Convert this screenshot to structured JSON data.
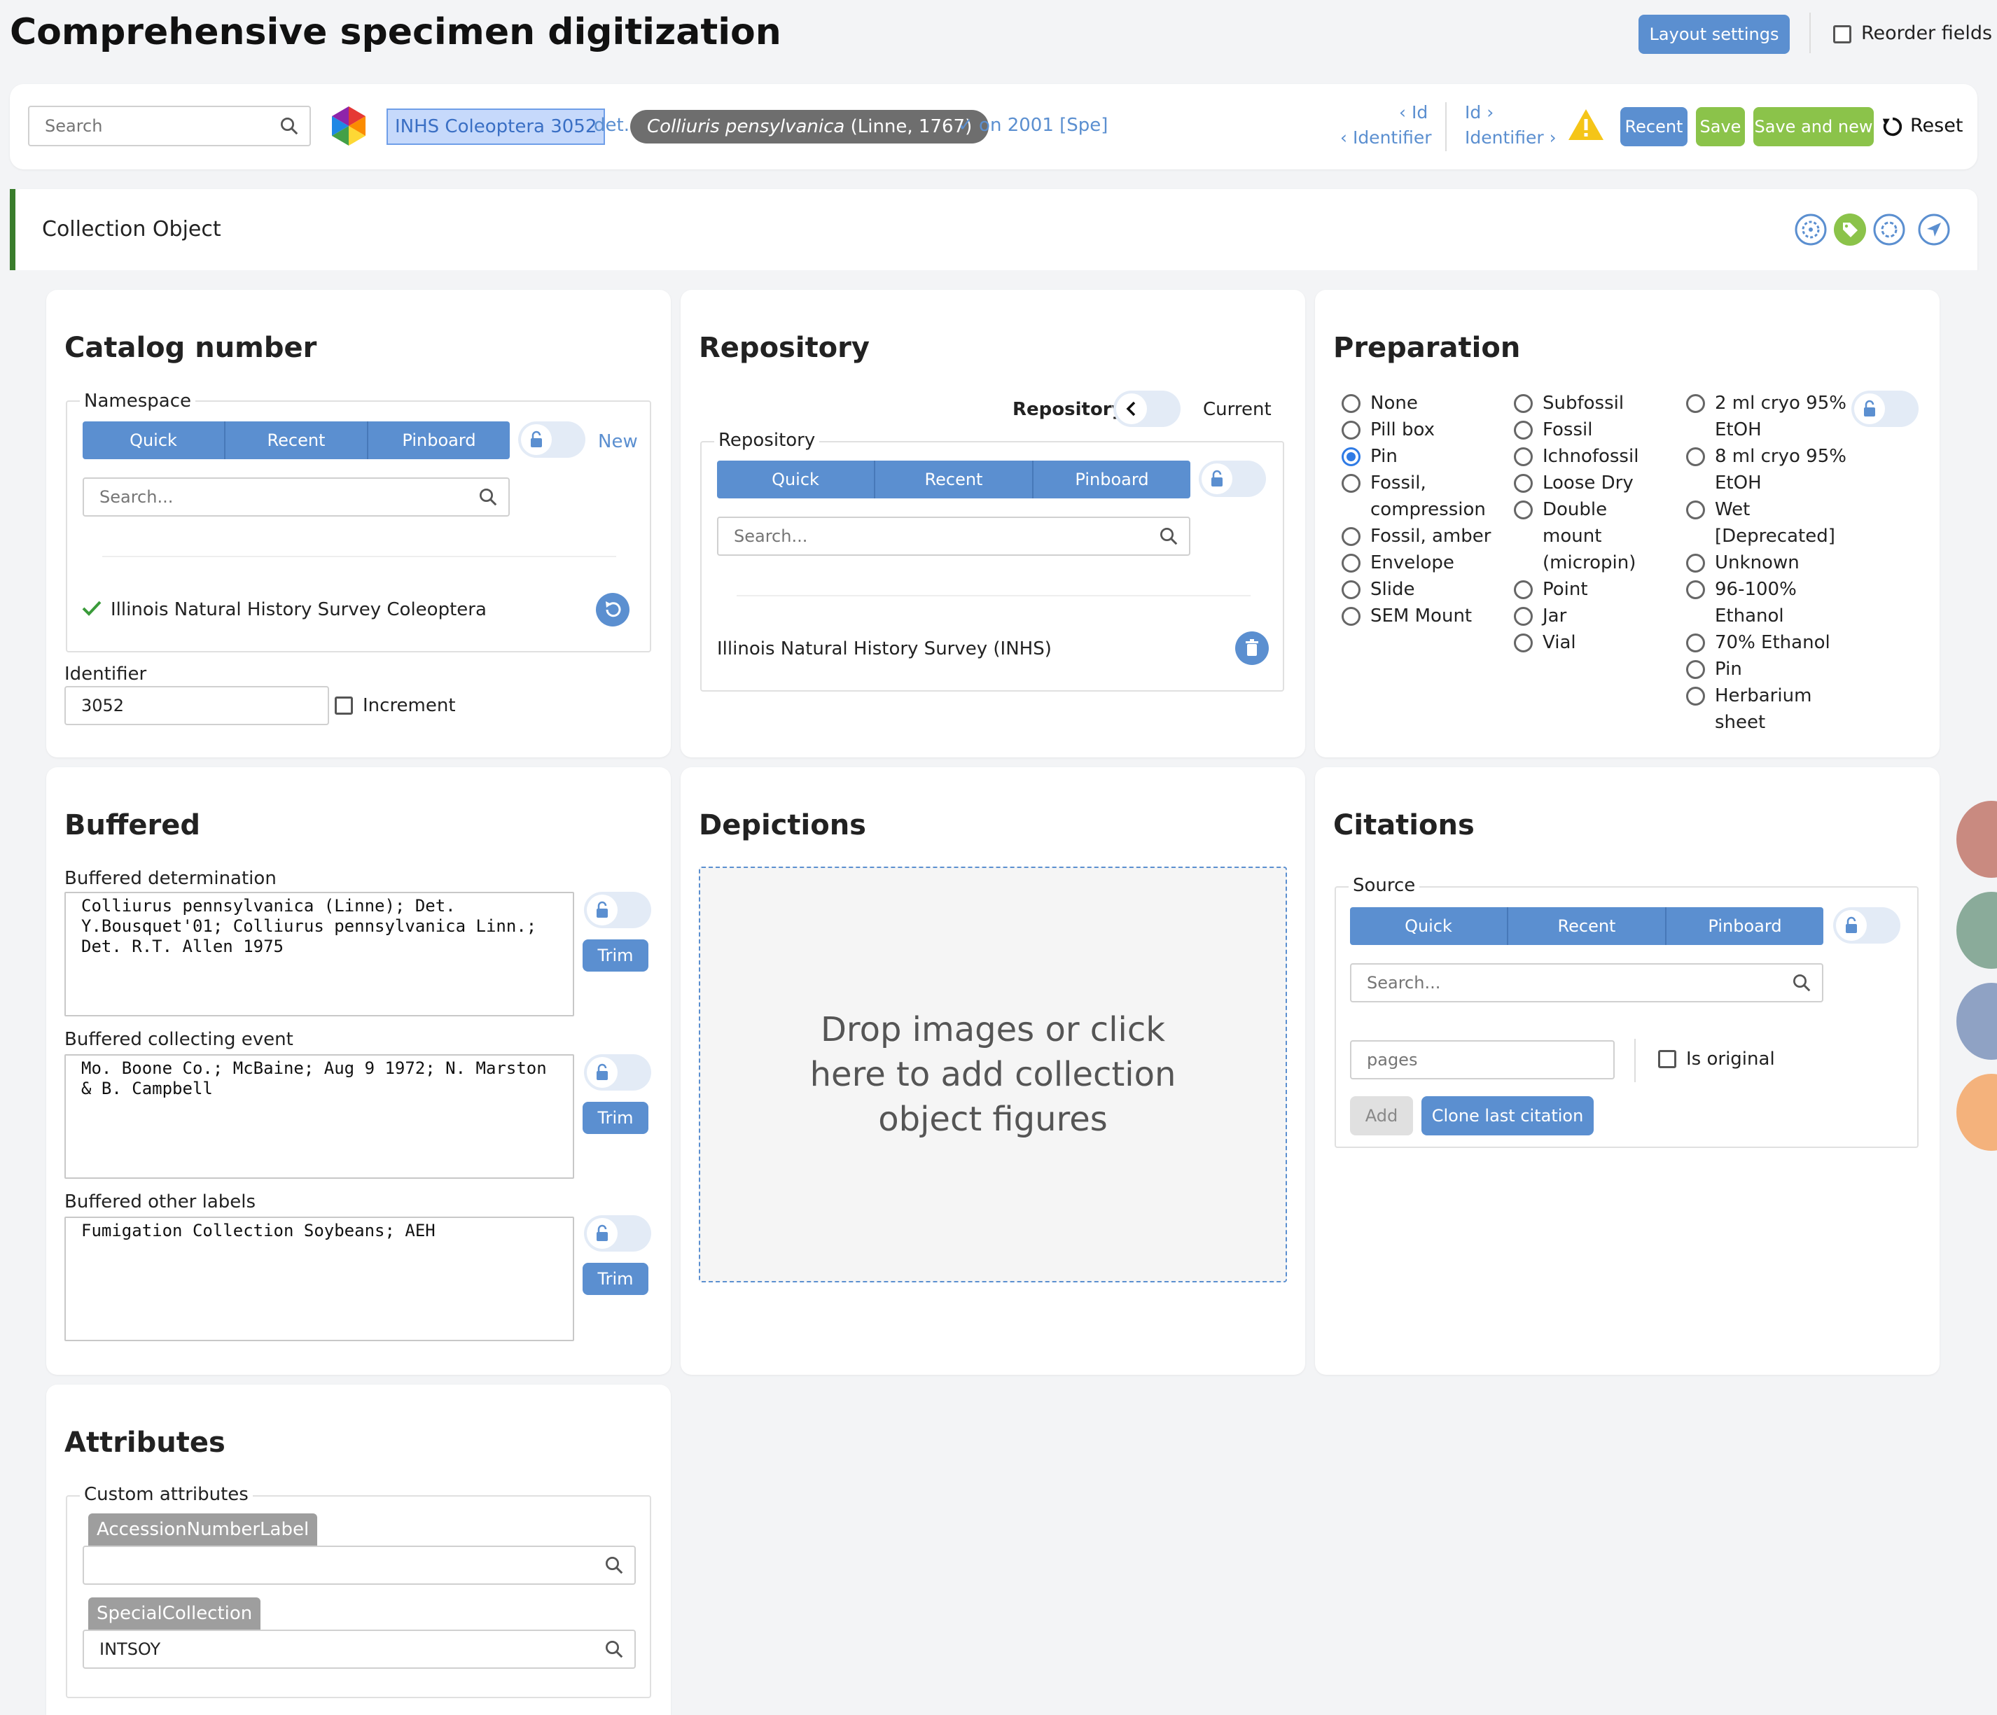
{
  "page_title": "Comprehensive specimen digitization",
  "header": {
    "layout_settings": "Layout settings",
    "reorder_fields": "Reorder fields"
  },
  "toolbar": {
    "search_placeholder": "Search",
    "object_label": "INHS Coleoptera 3052",
    "det": "det.",
    "taxon_name": "Colliuris pensylvanica",
    "taxon_author": "(Linne, 1767)",
    "det_info": "✓ on 2001 [Spe]",
    "prev_id": "‹ Id",
    "prev_identifier": "‹ Identifier",
    "next_id": "Id ›",
    "next_identifier": "Identifier ›",
    "recent": "Recent",
    "save": "Save",
    "save_and_new": "Save and new",
    "reset": "Reset"
  },
  "section_title": "Collection Object",
  "catalog": {
    "title": "Catalog number",
    "namespace_legend": "Namespace",
    "tabs": [
      "Quick",
      "Recent",
      "Pinboard"
    ],
    "new_link": "New",
    "search_placeholder": "Search...",
    "selected": "Illinois Natural History Survey Coleoptera",
    "identifier_label": "Identifier",
    "identifier_value": "3052",
    "increment_label": "Increment"
  },
  "repository": {
    "title": "Repository",
    "toggle_left": "Repository",
    "toggle_right": "Current",
    "legend": "Repository",
    "tabs": [
      "Quick",
      "Recent",
      "Pinboard"
    ],
    "search_placeholder": "Search...",
    "selected": "Illinois Natural History Survey (INHS)"
  },
  "preparation": {
    "title": "Preparation",
    "col1": [
      "None",
      "Pill box",
      "Pin",
      "Fossil, compression",
      "Fossil, amber",
      "Envelope",
      "Slide",
      "SEM Mount"
    ],
    "col2": [
      "Subfossil",
      "Fossil",
      "Ichnofossil",
      "Loose Dry",
      "Double mount (micropin)",
      "Point",
      "Jar",
      "Vial"
    ],
    "col3": [
      "2 ml cryo 95% EtOH",
      "8 ml cryo 95% EtOH",
      "Wet [Deprecated]",
      "Unknown",
      "96-100% Ethanol",
      "70% Ethanol",
      "Pin",
      "Herbarium sheet"
    ],
    "selected": "Pin"
  },
  "buffered": {
    "title": "Buffered",
    "determination_label": "Buffered determination",
    "determination_value": "Colliurus pennsylvanica (Linne); Det. Y.Bousquet'01; Colliurus pennsylvanica Linn.; Det. R.T. Allen 1975",
    "collecting_label": "Buffered collecting event",
    "collecting_value": "Mo. Boone Co.; McBaine; Aug 9 1972; N. Marston & B. Campbell",
    "other_label": "Buffered other labels",
    "other_value": "Fumigation Collection Soybeans; AEH",
    "trim": "Trim"
  },
  "depictions": {
    "title": "Depictions",
    "dropzone": "Drop images or click here to add collection object figures"
  },
  "citations": {
    "title": "Citations",
    "source_legend": "Source",
    "tabs": [
      "Quick",
      "Recent",
      "Pinboard"
    ],
    "search_placeholder": "Search...",
    "pages_placeholder": "pages",
    "is_original": "Is original",
    "add": "Add",
    "clone": "Clone last citation"
  },
  "attributes": {
    "title": "Attributes",
    "legend": "Custom attributes",
    "field1_label": "AccessionNumberLabel",
    "field1_value": "",
    "field2_label": "SpecialCollection",
    "field2_value": "INTSOY"
  },
  "colors": {
    "blue": "#5b8fd0",
    "green": "#8bc34a",
    "accent_bar": "#3a7d2c",
    "warning": "#f5c518"
  }
}
